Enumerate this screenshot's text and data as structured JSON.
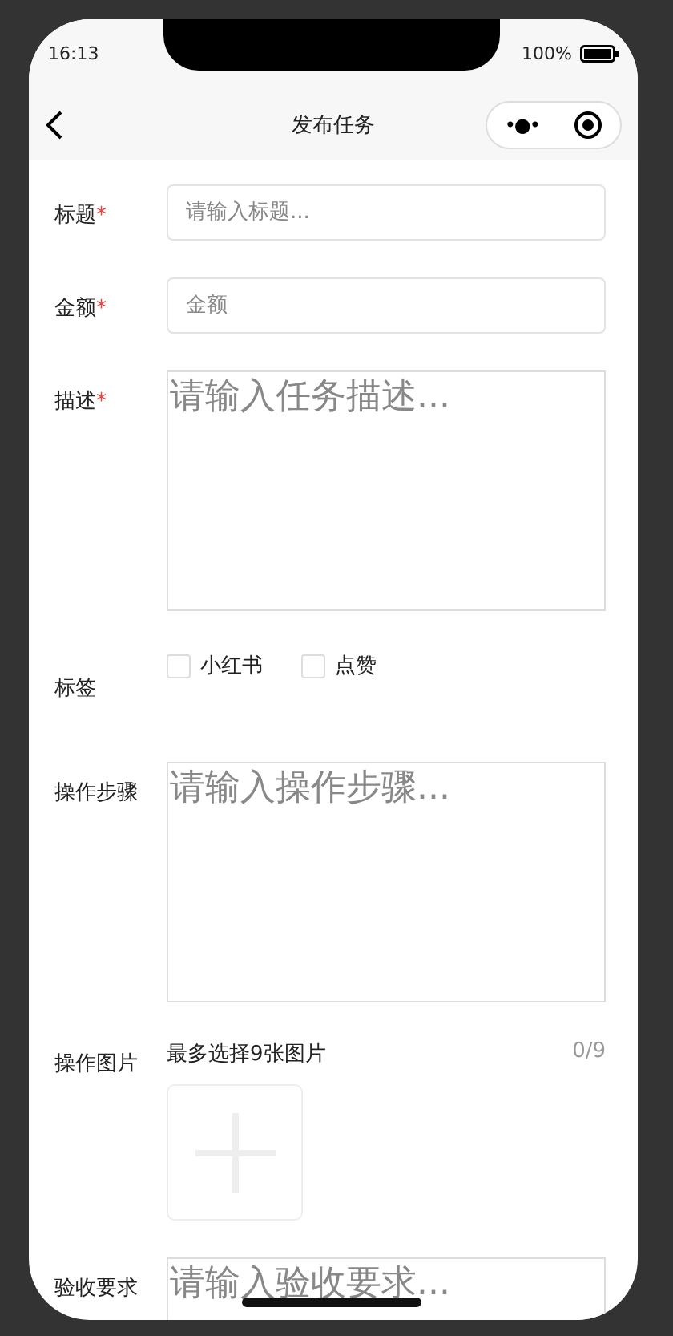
{
  "status_bar": {
    "time": "16:13",
    "battery_percent": "100%"
  },
  "nav": {
    "title": "发布任务",
    "menu_glyph": "•●•"
  },
  "form": {
    "fields": [
      {
        "kind": "input",
        "label": "标题",
        "required_mark": "*",
        "placeholder": "请输入标题..."
      },
      {
        "kind": "input",
        "label": "金额",
        "required_mark": "*",
        "placeholder": "金额"
      },
      {
        "kind": "textarea",
        "label": "描述",
        "required_mark": "*",
        "placeholder": "请输入任务描述..."
      },
      {
        "kind": "checkboxes",
        "label": "标签",
        "options": [
          {
            "label": "小红书",
            "checked": false
          },
          {
            "label": "点赞",
            "checked": false
          }
        ]
      },
      {
        "kind": "textarea",
        "label": "操作步骤",
        "placeholder": "请输入操作步骤..."
      },
      {
        "kind": "images",
        "label": "操作图片",
        "hint": "最多选择9张图片",
        "count": "0/9"
      },
      {
        "kind": "textarea",
        "label": "验收要求",
        "placeholder": "请输入验收要求..."
      }
    ]
  }
}
